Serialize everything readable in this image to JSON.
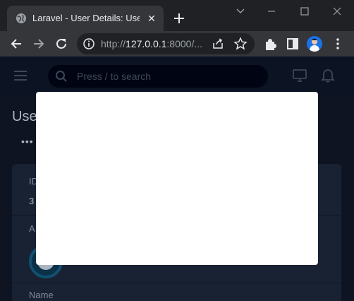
{
  "browser": {
    "tab_title": "Laravel - User Details: User",
    "tab_close": "✕",
    "url_prefix": "http://",
    "url_host": "127.0.0.1",
    "url_rest": ":8000/..."
  },
  "app": {
    "search_placeholder": "Press / to search",
    "page_title": "User",
    "breadcrumb_dots": "•••",
    "fields": {
      "id_label": "ID",
      "id_value": "3",
      "avatar_label": "A",
      "name_label": "Name"
    }
  },
  "colors": {
    "browser_bg": "#202124",
    "toolbar_bg": "#35363a",
    "page_bg": "#111827",
    "appbar_bg": "#0f172a",
    "card_bg": "#1e293b",
    "modal_bg": "#ffffff"
  },
  "icons": [
    "globe-icon",
    "close-icon",
    "plus-icon",
    "minimize-icon",
    "maximize-icon",
    "window-close-icon",
    "chevron-down-icon",
    "back-icon",
    "forward-icon",
    "reload-icon",
    "info-icon",
    "share-icon",
    "star-icon",
    "extensions-icon",
    "sidepanel-icon",
    "menu-icon",
    "hamburger-icon",
    "search-icon",
    "desktop-icon",
    "bell-icon"
  ]
}
